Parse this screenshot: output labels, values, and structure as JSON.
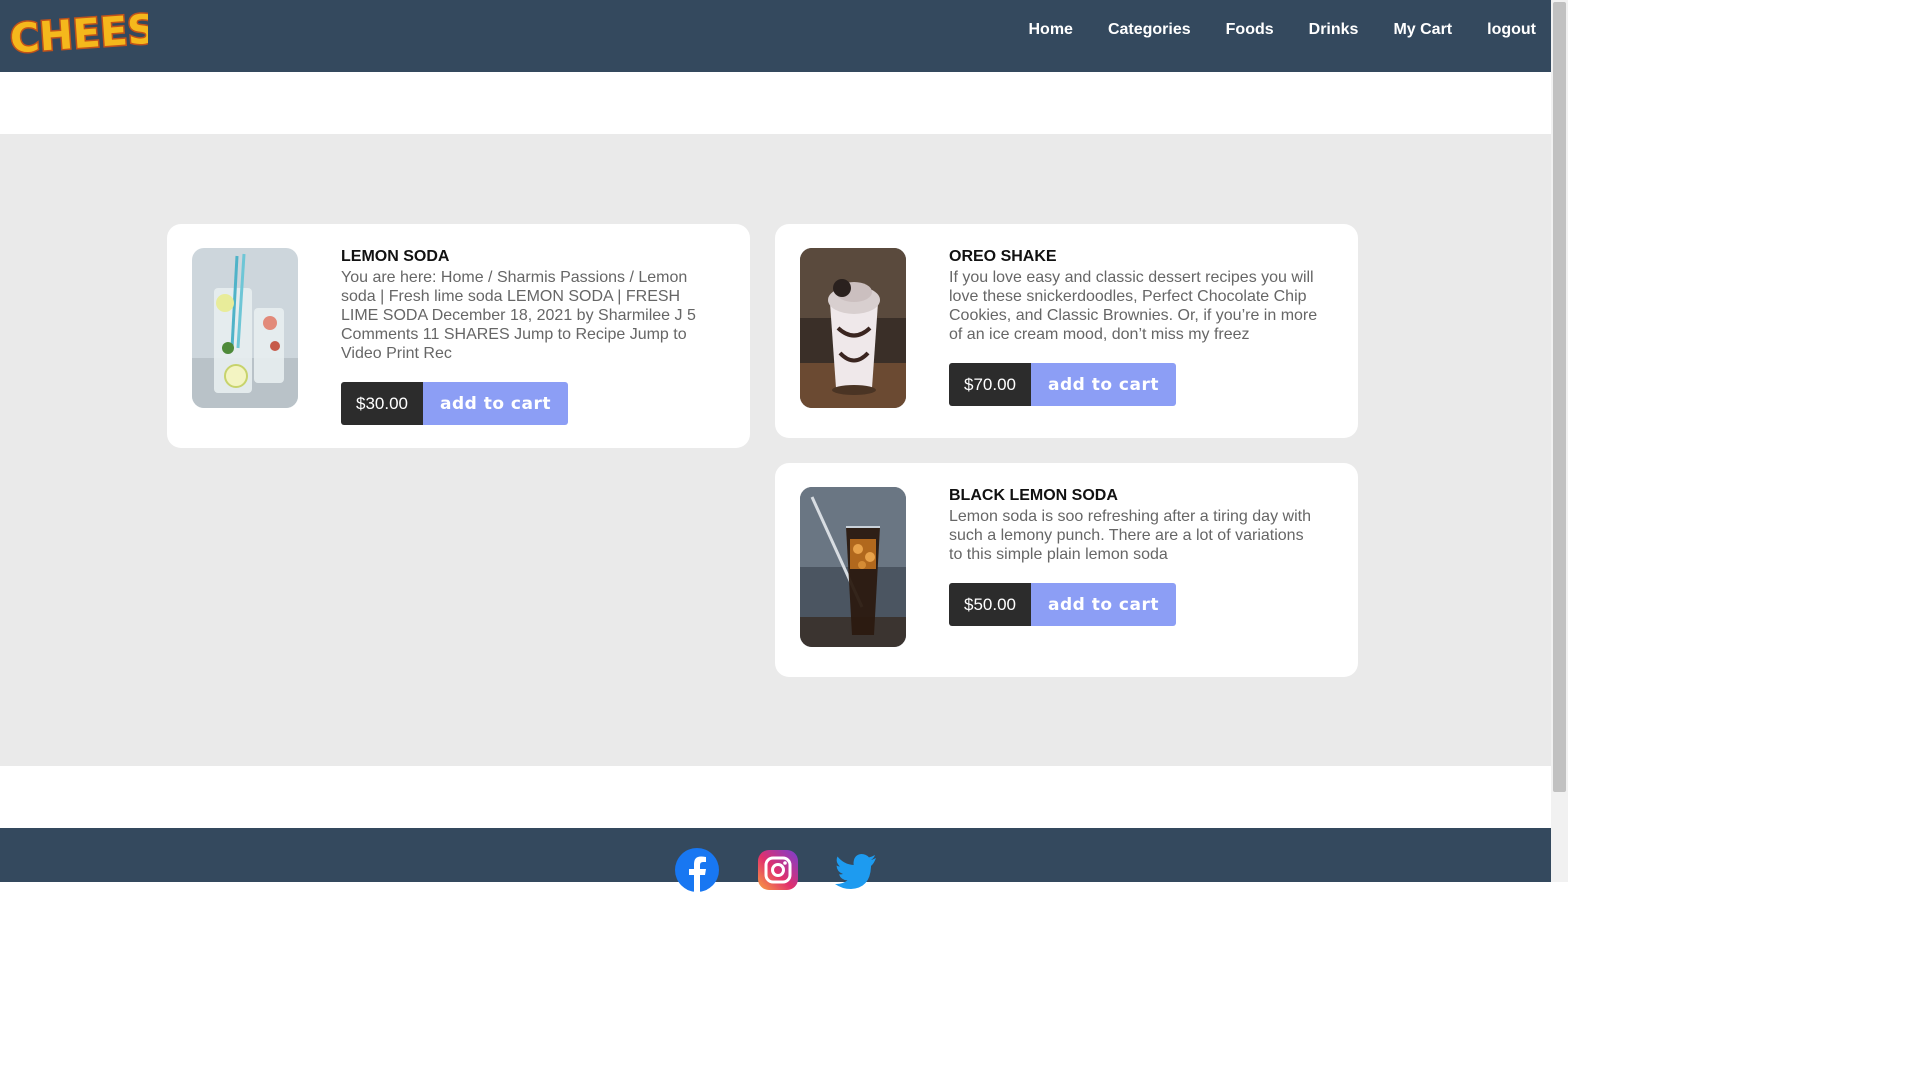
{
  "brand": {
    "logo_text": "CHEESY!"
  },
  "nav": {
    "items": [
      {
        "label": "Home"
      },
      {
        "label": "Categories"
      },
      {
        "label": "Foods"
      },
      {
        "label": "Drinks"
      },
      {
        "label": "My Cart"
      },
      {
        "label": "logout"
      }
    ]
  },
  "products": [
    {
      "title": "LEMON SODA",
      "description": "You are here: Home / Sharmis Passions / Lemon soda | Fresh lime soda LEMON SODA | FRESH LIME SODA December 18, 2021 by Sharmilee J 5 Comments 11 SHARES Jump to Recipe Jump to Video Print Rec",
      "price": "$30.00",
      "button": "add to cart"
    },
    {
      "title": "OREO SHAKE",
      "description": "If you love easy and classic dessert recipes you will love these snickerdoodles, Perfect Chocolate Chip Cookies, and Classic Brownies. Or, if you’re in more of an ice cream mood, don’t miss my freez",
      "price": "$70.00",
      "button": "add to cart"
    },
    {
      "title": "BLACK LEMON SODA",
      "description": "Lemon soda is soo refreshing after a tiring day with such a lemony punch. There are a lot of variations to this simple plain lemon soda",
      "price": "$50.00",
      "button": "add to cart"
    }
  ],
  "footer": {
    "social": [
      "facebook-icon",
      "instagram-icon",
      "twitter-icon"
    ]
  },
  "colors": {
    "navbar": "#34495e",
    "main_bg": "#eaeaea",
    "price_bg": "#2c2c2c",
    "button_bg": "#8c9ef5"
  }
}
